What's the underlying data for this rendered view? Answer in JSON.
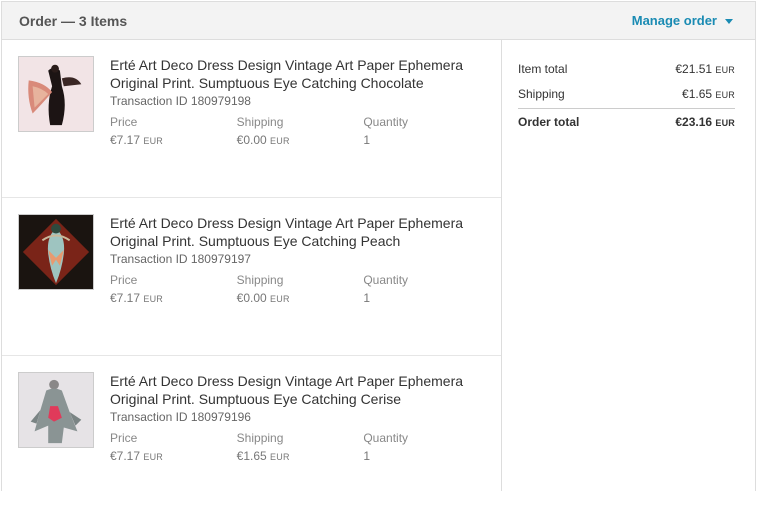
{
  "header": {
    "title": "Order — 3 Items",
    "manage_label": "Manage order"
  },
  "labels": {
    "transaction_prefix": "Transaction ID",
    "price": "Price",
    "shipping": "Shipping",
    "quantity": "Quantity"
  },
  "items": [
    {
      "title": "Erté Art Deco Dress Design Vintage Art Paper Ephemera Original Print. Sumptuous Eye Catching Chocolate",
      "transaction": "Transaction ID 180979198",
      "price": "€7.17",
      "price_cur": "EUR",
      "shipping": "€0.00",
      "shipping_cur": "EUR",
      "quantity": "1"
    },
    {
      "title": "Erté Art Deco Dress Design Vintage Art Paper Ephemera Original Print. Sumptuous Eye Catching Peach",
      "transaction": "Transaction ID 180979197",
      "price": "€7.17",
      "price_cur": "EUR",
      "shipping": "€0.00",
      "shipping_cur": "EUR",
      "quantity": "1"
    },
    {
      "title": "Erté Art Deco Dress Design Vintage Art Paper Ephemera Original Print. Sumptuous Eye Catching Cerise",
      "transaction": "Transaction ID 180979196",
      "price": "€7.17",
      "price_cur": "EUR",
      "shipping": "€1.65",
      "shipping_cur": "EUR",
      "quantity": "1"
    }
  ],
  "summary": {
    "item_total_label": "Item total",
    "item_total": "€21.51",
    "shipping_label": "Shipping",
    "shipping": "€1.65",
    "order_total_label": "Order total",
    "order_total": "€23.16",
    "currency": "EUR"
  },
  "colors": {
    "accent": "#1a8bb3",
    "header_bg": "#f3f3f3",
    "border": "#dddddd"
  }
}
